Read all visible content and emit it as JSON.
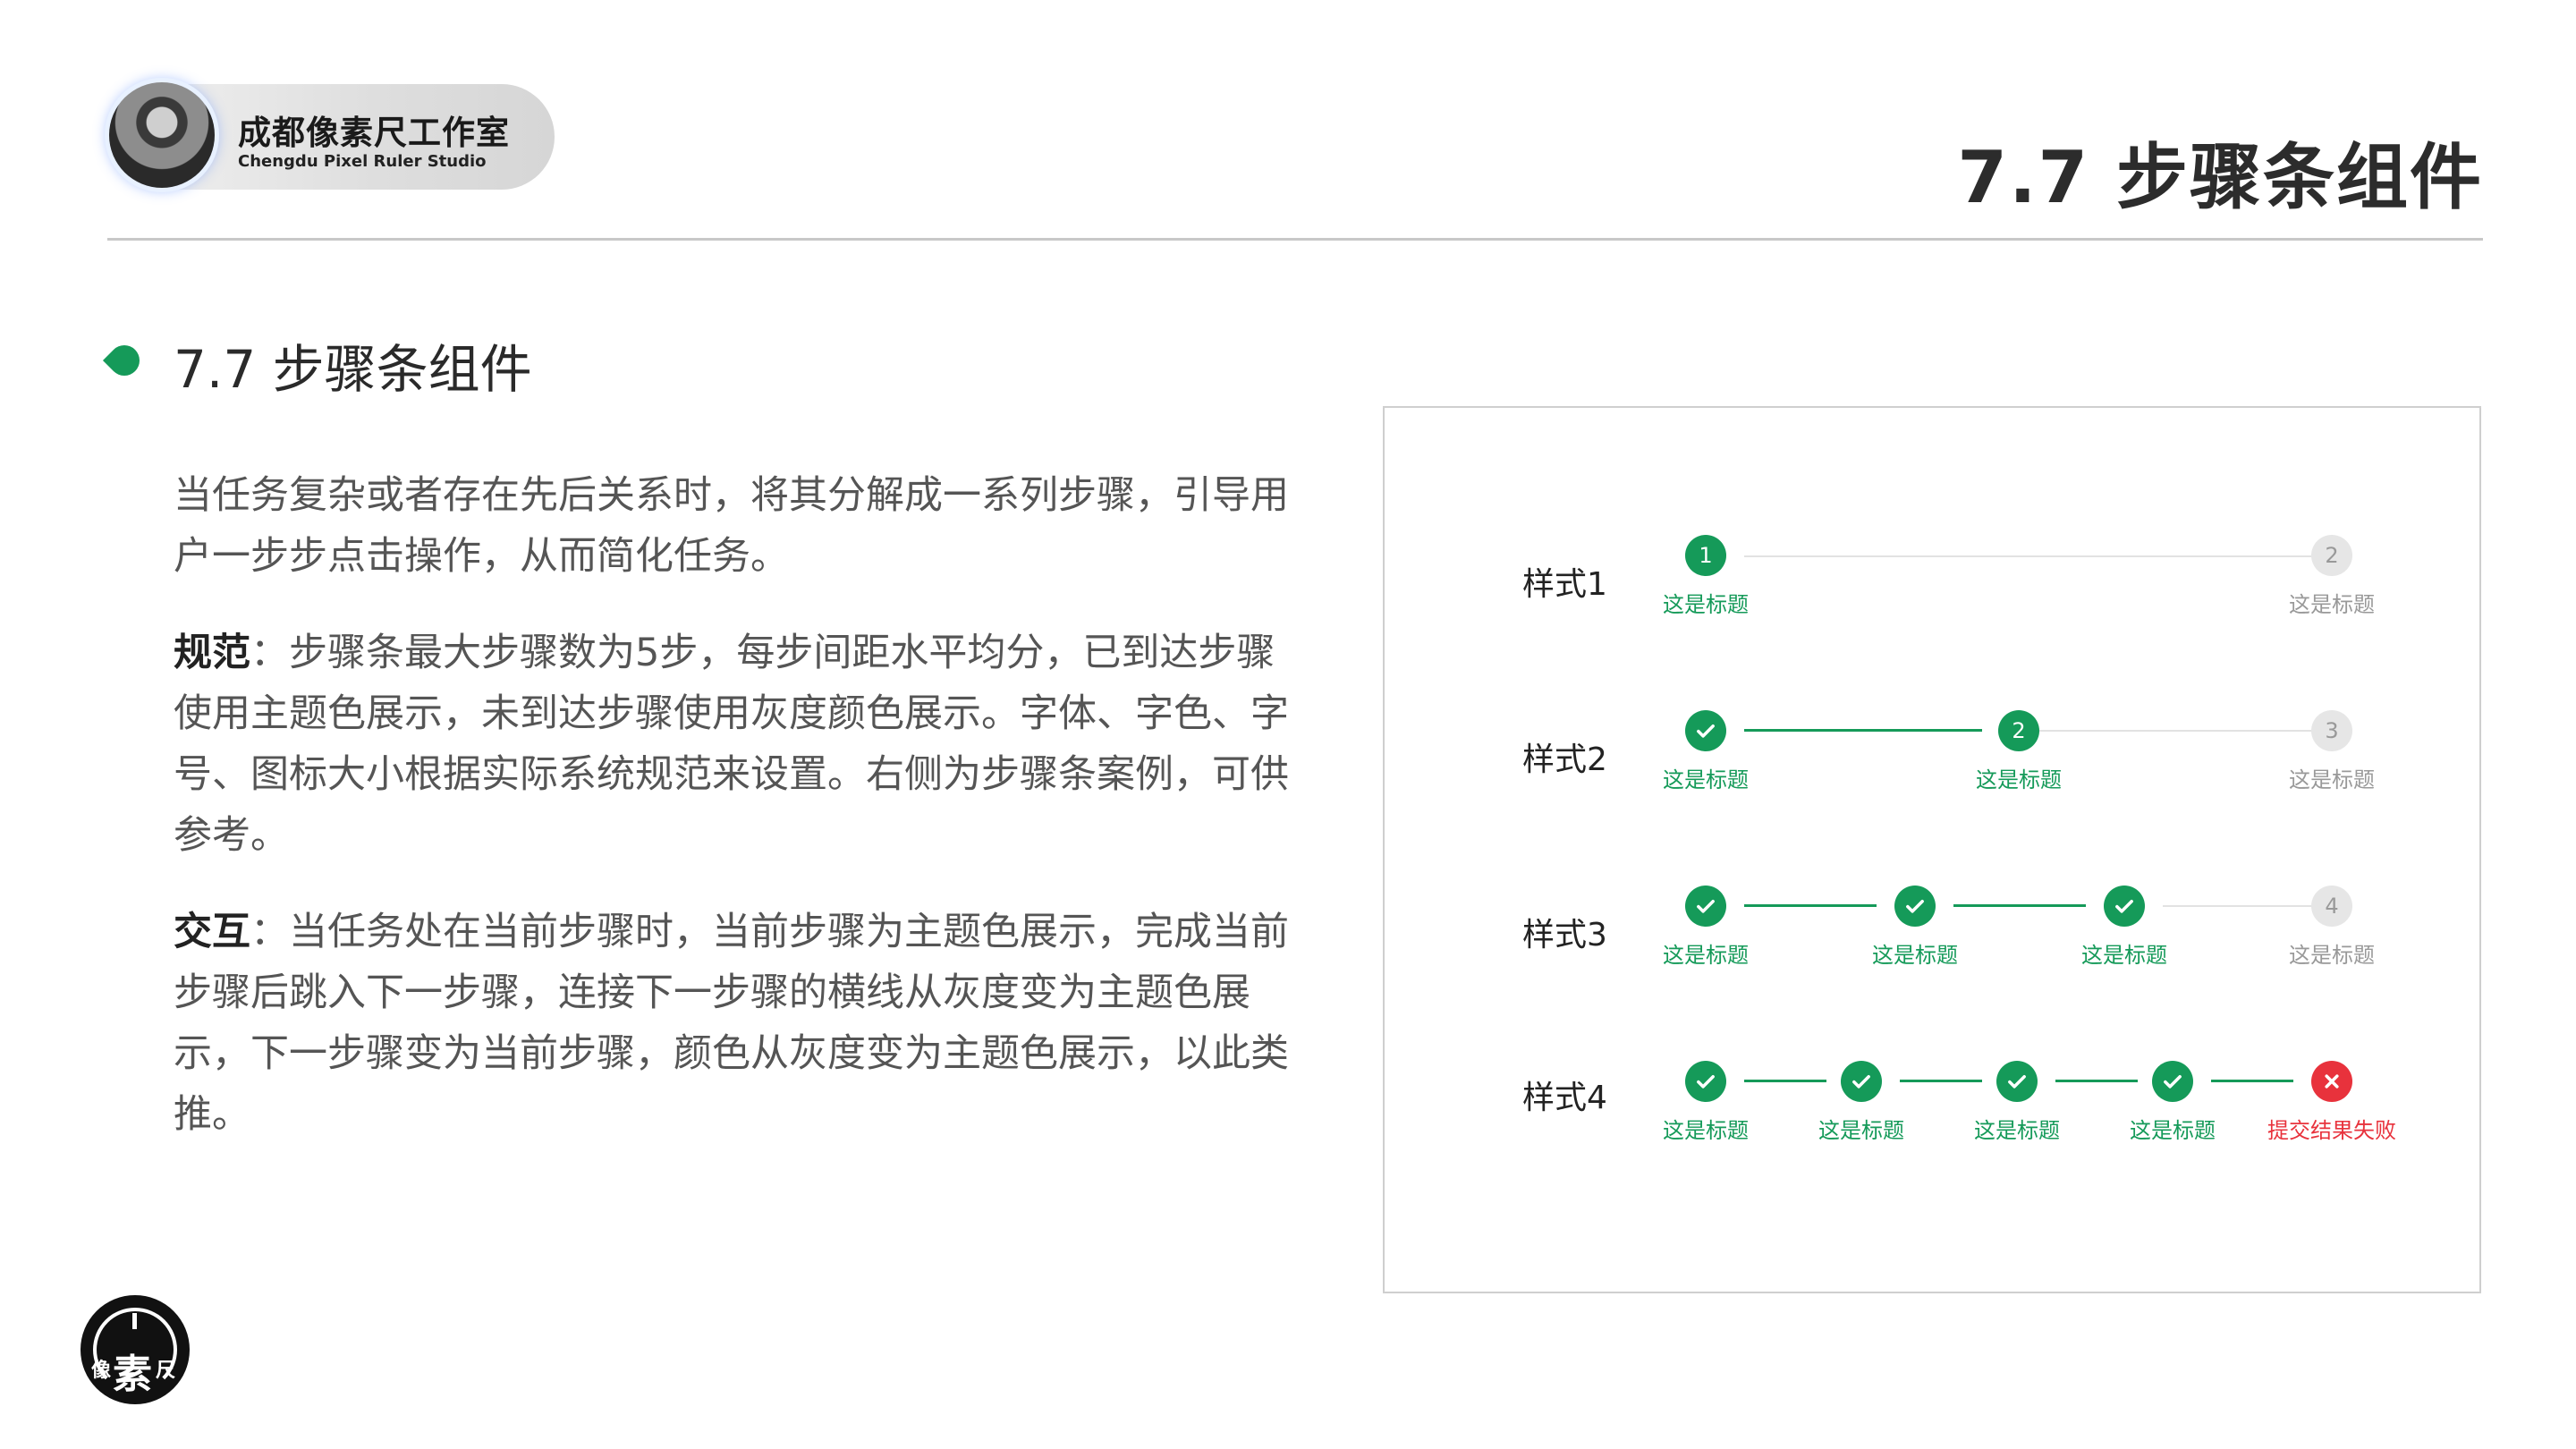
{
  "header": {
    "brand_name": "成都像素尺工作室",
    "brand_sub": "Chengdu Pixel Ruler Studio",
    "page_title": "7.7 步骤条组件"
  },
  "section": {
    "title": "7.7 步骤条组件"
  },
  "body": {
    "intro": "当任务复杂或者存在先后关系时，将其分解成一系列步骤，引导用户一步步点击操作，从而简化任务。",
    "spec_label": "规范",
    "spec_text": "：步骤条最大步骤数为5步，每步间距水平均分，已到达步骤使用主题色展示，未到达步骤使用灰度颜色展示。字体、字色、字号、图标大小根据实际系统规范来设置。右侧为步骤条案例，可供参考。",
    "interaction_label": "交互",
    "interaction_text": "：当任务处在当前步骤时，当前步骤为主题色展示，完成当前步骤后跳入下一步骤，连接下一步骤的横线从灰度变为主题色展示，下一步骤变为当前步骤，颜色从灰度变为主题色展示，以此类推。"
  },
  "examples": {
    "row1": {
      "label": "样式1",
      "steps": [
        {
          "num": "1",
          "title": "这是标题",
          "state": "active"
        },
        {
          "num": "2",
          "title": "这是标题",
          "state": "todo"
        }
      ]
    },
    "row2": {
      "label": "样式2",
      "steps": [
        {
          "num": "",
          "title": "这是标题",
          "state": "done"
        },
        {
          "num": "2",
          "title": "这是标题",
          "state": "active"
        },
        {
          "num": "3",
          "title": "这是标题",
          "state": "todo"
        }
      ]
    },
    "row3": {
      "label": "样式3",
      "steps": [
        {
          "num": "",
          "title": "这是标题",
          "state": "done"
        },
        {
          "num": "",
          "title": "这是标题",
          "state": "done"
        },
        {
          "num": "",
          "title": "这是标题",
          "state": "done"
        },
        {
          "num": "4",
          "title": "这是标题",
          "state": "todo"
        }
      ]
    },
    "row4": {
      "label": "样式4",
      "steps": [
        {
          "num": "",
          "title": "这是标题",
          "state": "done"
        },
        {
          "num": "",
          "title": "这是标题",
          "state": "done"
        },
        {
          "num": "",
          "title": "这是标题",
          "state": "done"
        },
        {
          "num": "",
          "title": "这是标题",
          "state": "done"
        },
        {
          "num": "",
          "title": "提交结果失败",
          "state": "fail"
        }
      ]
    }
  },
  "colors": {
    "theme_green": "#159a59",
    "inactive_gray": "#e6e6e6",
    "error_red": "#e8323c"
  },
  "footer": {
    "logo_glyph_left": "像",
    "logo_glyph_center": "素",
    "logo_glyph_right": "尺"
  }
}
